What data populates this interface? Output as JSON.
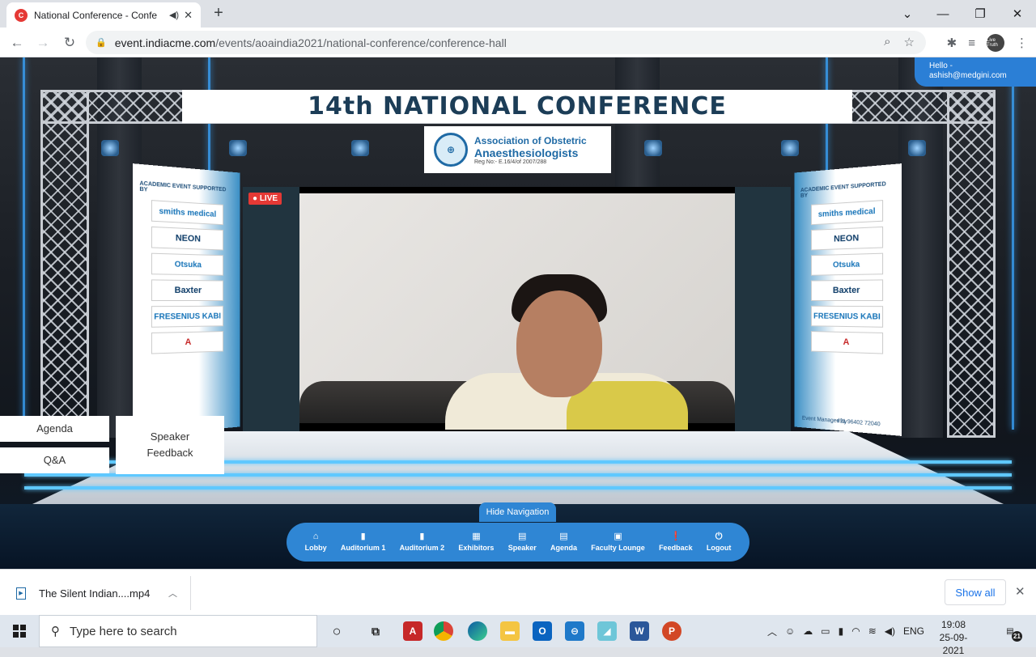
{
  "browser": {
    "tab_title": "National Conference - Confe",
    "tab_favicon": "C",
    "new_tab": "+",
    "url_domain": "event.indiacme.com",
    "url_path": "/events/aoaindia2021/national-conference/conference-hall",
    "profile_label": "Live Truth"
  },
  "page": {
    "banner_title": "14th NATIONAL CONFERENCE",
    "logo": {
      "line1": "Association of Obstetric",
      "line2": "Anaesthesiologists",
      "line3": "Reg No:- E.16/4/of 2007/288"
    },
    "hello_line1": "Hello -",
    "hello_line2": "ashish@medgini.com",
    "live_badge": "● LIVE",
    "side_banner": {
      "heading": "ACADEMIC EVENT SUPPORTED BY",
      "sponsors": [
        "smiths medical",
        "NEON",
        "Otsuka",
        "Baxter",
        "FRESENIUS KABI",
        "A"
      ],
      "footer_left": "Event Managed by",
      "footer_right": "+91 96402 72040"
    },
    "buttons": {
      "agenda": "Agenda",
      "qa": "Q&A",
      "speaker_feedback_1": "Speaker",
      "speaker_feedback_2": "Feedback"
    },
    "hide_navigation": "Hide Navigation",
    "nav_items": [
      {
        "label": "Lobby",
        "icon": "⌂"
      },
      {
        "label": "Auditorium 1",
        "icon": "▮"
      },
      {
        "label": "Auditorium 2",
        "icon": "▮"
      },
      {
        "label": "Exhibitors",
        "icon": "▦"
      },
      {
        "label": "Speaker",
        "icon": "▤"
      },
      {
        "label": "Agenda",
        "icon": "▤"
      },
      {
        "label": "Faculty Lounge",
        "icon": "▣"
      },
      {
        "label": "Feedback",
        "icon": "❗"
      },
      {
        "label": "Logout",
        "icon": "⏻"
      }
    ]
  },
  "downloads": {
    "file_name": "The Silent Indian....mp4",
    "show_all": "Show all"
  },
  "taskbar": {
    "search_placeholder": "Type here to search",
    "language": "ENG",
    "time": "19:08",
    "date": "25-09-2021",
    "notification_count": "21"
  }
}
